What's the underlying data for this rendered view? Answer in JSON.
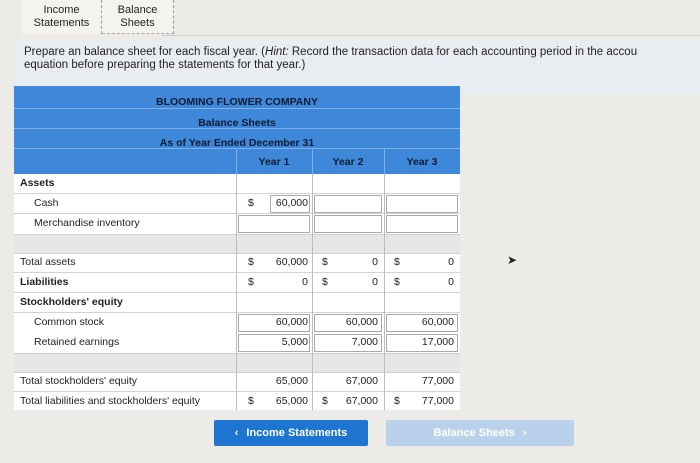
{
  "tabs": [
    {
      "label": "Income\nStatements",
      "l1": "Income",
      "l2": "Statements"
    },
    {
      "label": "Balance\nSheets",
      "l1": "Balance",
      "l2": "Sheets"
    }
  ],
  "instruction": {
    "prefix": "Prepare an balance sheet for each fiscal year. (",
    "hint": "Hint:",
    "line1_rest": " Record the transaction data for each accounting period in the accou",
    "line2": "equation before preparing the statements for that year.)"
  },
  "header": {
    "company": "BLOOMING FLOWER COMPANY",
    "statement": "Balance Sheets",
    "period": "As of Year Ended December 31",
    "years": [
      "Year 1",
      "Year 2",
      "Year 3"
    ]
  },
  "rows": {
    "assets": "Assets",
    "cash": {
      "label": "Cash",
      "dollar": "$",
      "y1": "60,000"
    },
    "merch": {
      "label": "Merchandise inventory"
    },
    "total_assets": {
      "label": "Total assets",
      "d": "$",
      "y1": "60,000",
      "y2": "0",
      "y3": "0"
    },
    "liabilities": {
      "label": "Liabilities",
      "d": "$",
      "y1": "0",
      "y2": "0",
      "y3": "0"
    },
    "equity": "Stockholders' equity",
    "common": {
      "label": "Common stock",
      "y1": "60,000",
      "y2": "60,000",
      "y3": "60,000"
    },
    "retained": {
      "label": "Retained earnings",
      "y1": "5,000",
      "y2": "7,000",
      "y3": "17,000"
    },
    "total_se": {
      "label": "Total stockholders' equity",
      "y1": "65,000",
      "y2": "67,000",
      "y3": "77,000"
    },
    "total_le": {
      "label": "Total liabilities and stockholders' equity",
      "d": "$",
      "y1": "65,000",
      "y2": "67,000",
      "y3": "77,000"
    }
  },
  "nav": {
    "prev": "Income Statements",
    "next": "Balance Sheets"
  }
}
